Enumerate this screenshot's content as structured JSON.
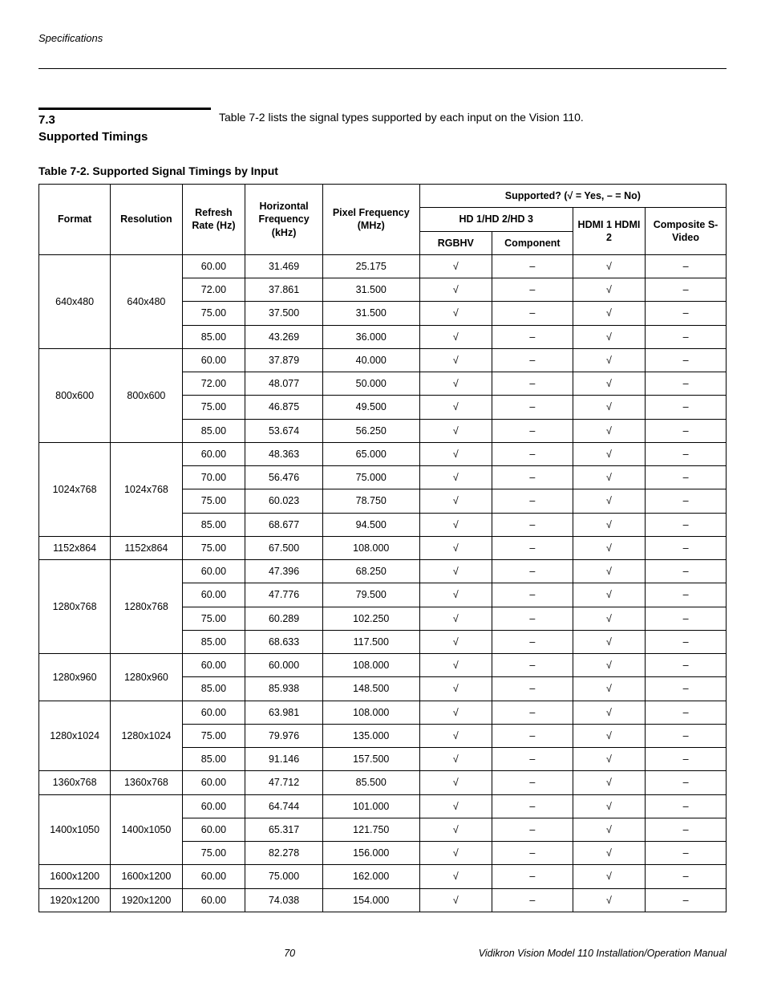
{
  "header_label": "Specifications",
  "section": {
    "number": "7.3",
    "title": "Supported Timings",
    "intro": "Table 7-2 lists the signal types supported by each input on the Vision 110."
  },
  "table": {
    "caption": "Table 7-2. Supported Signal Timings by Input",
    "head": {
      "format": "Format",
      "resolution": "Resolution",
      "refresh": "Refresh Rate (Hz)",
      "hfreq": "Horizontal Frequency (kHz)",
      "pfreq": "Pixel Frequency (MHz)",
      "supported": "Supported? (√ = Yes, – = No)",
      "hd": "HD 1/HD 2/HD 3",
      "rgbhv": "RGBHV",
      "component": "Component",
      "hdmi": "HDMI 1 HDMI 2",
      "composite": "Composite S-Video"
    },
    "groups": [
      {
        "format": "640x480",
        "resolution": "640x480",
        "rows": [
          {
            "refresh": "60.00",
            "hfreq": "31.469",
            "pfreq": "25.175",
            "rgbhv": "√",
            "component": "–",
            "hdmi": "√",
            "composite": "–"
          },
          {
            "refresh": "72.00",
            "hfreq": "37.861",
            "pfreq": "31.500",
            "rgbhv": "√",
            "component": "–",
            "hdmi": "√",
            "composite": "–"
          },
          {
            "refresh": "75.00",
            "hfreq": "37.500",
            "pfreq": "31.500",
            "rgbhv": "√",
            "component": "–",
            "hdmi": "√",
            "composite": "–"
          },
          {
            "refresh": "85.00",
            "hfreq": "43.269",
            "pfreq": "36.000",
            "rgbhv": "√",
            "component": "–",
            "hdmi": "√",
            "composite": "–"
          }
        ]
      },
      {
        "format": "800x600",
        "resolution": "800x600",
        "rows": [
          {
            "refresh": "60.00",
            "hfreq": "37.879",
            "pfreq": "40.000",
            "rgbhv": "√",
            "component": "–",
            "hdmi": "√",
            "composite": "–"
          },
          {
            "refresh": "72.00",
            "hfreq": "48.077",
            "pfreq": "50.000",
            "rgbhv": "√",
            "component": "–",
            "hdmi": "√",
            "composite": "–"
          },
          {
            "refresh": "75.00",
            "hfreq": "46.875",
            "pfreq": "49.500",
            "rgbhv": "√",
            "component": "–",
            "hdmi": "√",
            "composite": "–"
          },
          {
            "refresh": "85.00",
            "hfreq": "53.674",
            "pfreq": "56.250",
            "rgbhv": "√",
            "component": "–",
            "hdmi": "√",
            "composite": "–"
          }
        ]
      },
      {
        "format": "1024x768",
        "resolution": "1024x768",
        "rows": [
          {
            "refresh": "60.00",
            "hfreq": "48.363",
            "pfreq": "65.000",
            "rgbhv": "√",
            "component": "–",
            "hdmi": "√",
            "composite": "–"
          },
          {
            "refresh": "70.00",
            "hfreq": "56.476",
            "pfreq": "75.000",
            "rgbhv": "√",
            "component": "–",
            "hdmi": "√",
            "composite": "–"
          },
          {
            "refresh": "75.00",
            "hfreq": "60.023",
            "pfreq": "78.750",
            "rgbhv": "√",
            "component": "–",
            "hdmi": "√",
            "composite": "–"
          },
          {
            "refresh": "85.00",
            "hfreq": "68.677",
            "pfreq": "94.500",
            "rgbhv": "√",
            "component": "–",
            "hdmi": "√",
            "composite": "–"
          }
        ]
      },
      {
        "format": "1152x864",
        "resolution": "1152x864",
        "rows": [
          {
            "refresh": "75.00",
            "hfreq": "67.500",
            "pfreq": "108.000",
            "rgbhv": "√",
            "component": "–",
            "hdmi": "√",
            "composite": "–"
          }
        ]
      },
      {
        "format": "1280x768",
        "resolution": "1280x768",
        "rows": [
          {
            "refresh": "60.00",
            "hfreq": "47.396",
            "pfreq": "68.250",
            "rgbhv": "√",
            "component": "–",
            "hdmi": "√",
            "composite": "–"
          },
          {
            "refresh": "60.00",
            "hfreq": "47.776",
            "pfreq": "79.500",
            "rgbhv": "√",
            "component": "–",
            "hdmi": "√",
            "composite": "–"
          },
          {
            "refresh": "75.00",
            "hfreq": "60.289",
            "pfreq": "102.250",
            "rgbhv": "√",
            "component": "–",
            "hdmi": "√",
            "composite": "–"
          },
          {
            "refresh": "85.00",
            "hfreq": "68.633",
            "pfreq": "117.500",
            "rgbhv": "√",
            "component": "–",
            "hdmi": "√",
            "composite": "–"
          }
        ]
      },
      {
        "format": "1280x960",
        "resolution": "1280x960",
        "rows": [
          {
            "refresh": "60.00",
            "hfreq": "60.000",
            "pfreq": "108.000",
            "rgbhv": "√",
            "component": "–",
            "hdmi": "√",
            "composite": "–"
          },
          {
            "refresh": "85.00",
            "hfreq": "85.938",
            "pfreq": "148.500",
            "rgbhv": "√",
            "component": "–",
            "hdmi": "√",
            "composite": "–"
          }
        ]
      },
      {
        "format": "1280x1024",
        "resolution": "1280x1024",
        "rows": [
          {
            "refresh": "60.00",
            "hfreq": "63.981",
            "pfreq": "108.000",
            "rgbhv": "√",
            "component": "–",
            "hdmi": "√",
            "composite": "–"
          },
          {
            "refresh": "75.00",
            "hfreq": "79.976",
            "pfreq": "135.000",
            "rgbhv": "√",
            "component": "–",
            "hdmi": "√",
            "composite": "–"
          },
          {
            "refresh": "85.00",
            "hfreq": "91.146",
            "pfreq": "157.500",
            "rgbhv": "√",
            "component": "–",
            "hdmi": "√",
            "composite": "–"
          }
        ]
      },
      {
        "format": "1360x768",
        "resolution": "1360x768",
        "rows": [
          {
            "refresh": "60.00",
            "hfreq": "47.712",
            "pfreq": "85.500",
            "rgbhv": "√",
            "component": "–",
            "hdmi": "√",
            "composite": "–"
          }
        ]
      },
      {
        "format": "1400x1050",
        "resolution": "1400x1050",
        "rows": [
          {
            "refresh": "60.00",
            "hfreq": "64.744",
            "pfreq": "101.000",
            "rgbhv": "√",
            "component": "–",
            "hdmi": "√",
            "composite": "–"
          },
          {
            "refresh": "60.00",
            "hfreq": "65.317",
            "pfreq": "121.750",
            "rgbhv": "√",
            "component": "–",
            "hdmi": "√",
            "composite": "–"
          },
          {
            "refresh": "75.00",
            "hfreq": "82.278",
            "pfreq": "156.000",
            "rgbhv": "√",
            "component": "–",
            "hdmi": "√",
            "composite": "–"
          }
        ]
      },
      {
        "format": "1600x1200",
        "resolution": "1600x1200",
        "rows": [
          {
            "refresh": "60.00",
            "hfreq": "75.000",
            "pfreq": "162.000",
            "rgbhv": "√",
            "component": "–",
            "hdmi": "√",
            "composite": "–"
          }
        ]
      },
      {
        "format": "1920x1200",
        "resolution": "1920x1200",
        "rows": [
          {
            "refresh": "60.00",
            "hfreq": "74.038",
            "pfreq": "154.000",
            "rgbhv": "√",
            "component": "–",
            "hdmi": "√",
            "composite": "–"
          }
        ]
      }
    ]
  },
  "footer": {
    "page": "70",
    "manual": "Vidikron Vision Model 110 Installation/Operation Manual"
  }
}
